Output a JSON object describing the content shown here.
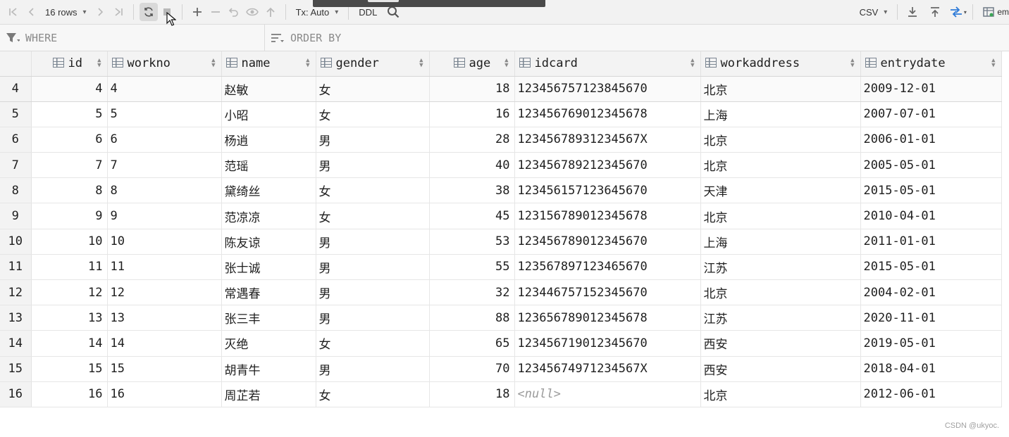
{
  "toolbar": {
    "rows_label": "16 rows",
    "tx_label": "Tx: Auto",
    "ddl_label": "DDL",
    "export_format": "CSV",
    "cut_label": "em"
  },
  "filter": {
    "where_label": "WHERE",
    "orderby_label": "ORDER BY"
  },
  "columns": [
    "id",
    "workno",
    "name",
    "gender",
    "age",
    "idcard",
    "workaddress",
    "entrydate"
  ],
  "rows": [
    {
      "n": "4",
      "id": "4",
      "workno": "4",
      "name": "赵敏",
      "gender": "女",
      "age": "18",
      "idcard": "123456757123845670",
      "workaddress": "北京",
      "entrydate": "2009-12-01"
    },
    {
      "n": "5",
      "id": "5",
      "workno": "5",
      "name": "小昭",
      "gender": "女",
      "age": "16",
      "idcard": "123456769012345678",
      "workaddress": "上海",
      "entrydate": "2007-07-01"
    },
    {
      "n": "6",
      "id": "6",
      "workno": "6",
      "name": "杨逍",
      "gender": "男",
      "age": "28",
      "idcard": "12345678931234567X",
      "workaddress": "北京",
      "entrydate": "2006-01-01"
    },
    {
      "n": "7",
      "id": "7",
      "workno": "7",
      "name": "范瑶",
      "gender": "男",
      "age": "40",
      "idcard": "123456789212345670",
      "workaddress": "北京",
      "entrydate": "2005-05-01"
    },
    {
      "n": "8",
      "id": "8",
      "workno": "8",
      "name": "黛绮丝",
      "gender": "女",
      "age": "38",
      "idcard": "123456157123645670",
      "workaddress": "天津",
      "entrydate": "2015-05-01"
    },
    {
      "n": "9",
      "id": "9",
      "workno": "9",
      "name": "范凉凉",
      "gender": "女",
      "age": "45",
      "idcard": "123156789012345678",
      "workaddress": "北京",
      "entrydate": "2010-04-01"
    },
    {
      "n": "10",
      "id": "10",
      "workno": "10",
      "name": "陈友谅",
      "gender": "男",
      "age": "53",
      "idcard": "123456789012345670",
      "workaddress": "上海",
      "entrydate": "2011-01-01"
    },
    {
      "n": "11",
      "id": "11",
      "workno": "11",
      "name": "张士诚",
      "gender": "男",
      "age": "55",
      "idcard": "123567897123465670",
      "workaddress": "江苏",
      "entrydate": "2015-05-01"
    },
    {
      "n": "12",
      "id": "12",
      "workno": "12",
      "name": "常遇春",
      "gender": "男",
      "age": "32",
      "idcard": "123446757152345670",
      "workaddress": "北京",
      "entrydate": "2004-02-01"
    },
    {
      "n": "13",
      "id": "13",
      "workno": "13",
      "name": "张三丰",
      "gender": "男",
      "age": "88",
      "idcard": "123656789012345678",
      "workaddress": "江苏",
      "entrydate": "2020-11-01"
    },
    {
      "n": "14",
      "id": "14",
      "workno": "14",
      "name": "灭绝",
      "gender": "女",
      "age": "65",
      "idcard": "123456719012345670",
      "workaddress": "西安",
      "entrydate": "2019-05-01"
    },
    {
      "n": "15",
      "id": "15",
      "workno": "15",
      "name": "胡青牛",
      "gender": "男",
      "age": "70",
      "idcard": "12345674971234567X",
      "workaddress": "西安",
      "entrydate": "2018-04-01"
    },
    {
      "n": "16",
      "id": "16",
      "workno": "16",
      "name": "周芷若",
      "gender": "女",
      "age": "18",
      "idcard": "<null>",
      "workaddress": "北京",
      "entrydate": "2012-06-01"
    }
  ],
  "watermark": "CSDN @ukyoc."
}
